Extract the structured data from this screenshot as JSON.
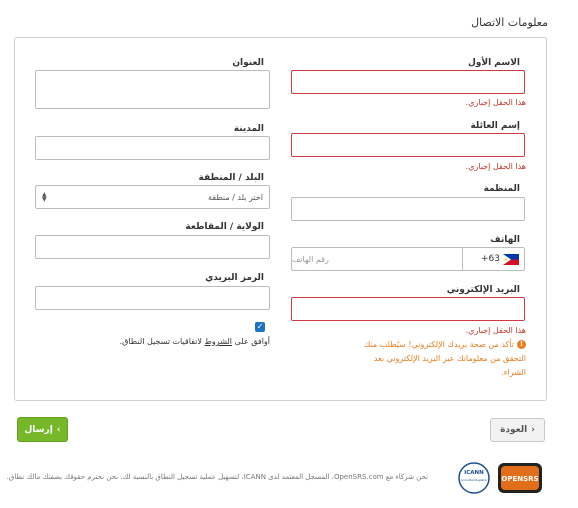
{
  "section_title": "معلومات الاتصال",
  "fields": {
    "first_name": {
      "label": "الاسم الأول",
      "error": "هذا الحقل إجباري."
    },
    "last_name": {
      "label": "إسم العائلة",
      "error": "هذا الحقل إجباري."
    },
    "organization": {
      "label": "المنظمة"
    },
    "phone": {
      "label": "الهاتف",
      "country_code": "+63",
      "placeholder": "رقم الهاتف"
    },
    "email": {
      "label": "البريد الإلكتروني",
      "error": "هذا الحقل إجباري.",
      "warning_line1": "تأكد من صحة بريدك الإلكتروني! سيُطلب منك",
      "warning_line2": "التحقق من معلوماتك عبر البريد الإلكتروني بعد",
      "warning_line3": "الشراء."
    },
    "address": {
      "label": "العنوان"
    },
    "city": {
      "label": "المدينة"
    },
    "country": {
      "label": "البلد / المنطقة",
      "selected": "اختر بلد / منطقة"
    },
    "state": {
      "label": "الولاية / المقاطعة"
    },
    "postal": {
      "label": "الرمز البريدي"
    }
  },
  "agree": {
    "prefix": "أوافق على ",
    "link": "الشروط",
    "suffix": " لاتفاقيات تسجيل النطاق."
  },
  "buttons": {
    "submit": "إرسال",
    "back": "العودة"
  },
  "footer": "نحن شركاء مع OpenSRS.com، المسجل المعتمد لدى ICANN، لتسهيل عملية تسجيل النطاق بالنسبة لك. نحن نحترم حقوقك بصفتك مالك نطاق.",
  "logos": {
    "icann": "ICANN",
    "icann_sub": "Accredited Registrar",
    "opensrs": "OPENSRS"
  },
  "colors": {
    "error": "#c0392b",
    "warning": "#e67e22",
    "submit": "#76b82a",
    "checkbox": "#1e73be"
  }
}
